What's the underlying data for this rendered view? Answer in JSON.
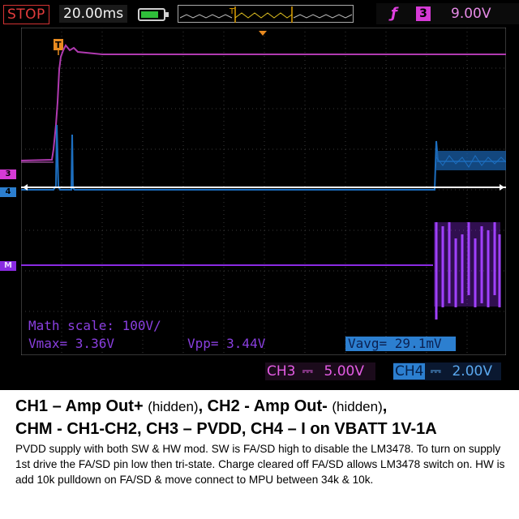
{
  "status": {
    "run_state": "STOP",
    "timebase": "20.00ms"
  },
  "trigger": {
    "source": "3",
    "level": "9.00V",
    "edge_icon": "rising-edge-icon"
  },
  "channels": {
    "ch3": {
      "tag": "CH3",
      "coupling_icon": "dc-coupling-icon",
      "scale": "5.00V",
      "color": "#d63ad6"
    },
    "ch4": {
      "tag": "CH4",
      "coupling_icon": "dc-coupling-icon",
      "scale": "2.00V",
      "color": "#2c7fd0"
    },
    "math": {
      "color": "#8a2be2"
    }
  },
  "markers": {
    "ch3": "3",
    "ch4": "4",
    "math": "M"
  },
  "measurements": {
    "math_scale": "Math scale: 100V/",
    "vmax": "Vmax= 3.36V",
    "vpp": "Vpp= 3.44V",
    "vavg": "Vavg= 29.1mV"
  },
  "caption": {
    "line1_a": "CH1 – Amp Out+ ",
    "line1_b": "(hidden)",
    "line1_c": ", CH2 - Amp Out- ",
    "line1_d": "(hidden)",
    "line1_e": ",",
    "line2": "CHM - CH1-CH2, CH3 – PVDD, CH4 – I on VBATT 1V-1A",
    "paragraph": "PVDD supply with both SW & HW mod. SW is FA/SD high to disable the LM3478. To turn on supply 1st drive the FA/SD pin low then tri-state. Charge cleared off FA/SD allows LM3478 switch on. HW is add 10k pulldown on FA/SD & move connect to MPU between 34k & 10k."
  },
  "battery_level": 0.8
}
